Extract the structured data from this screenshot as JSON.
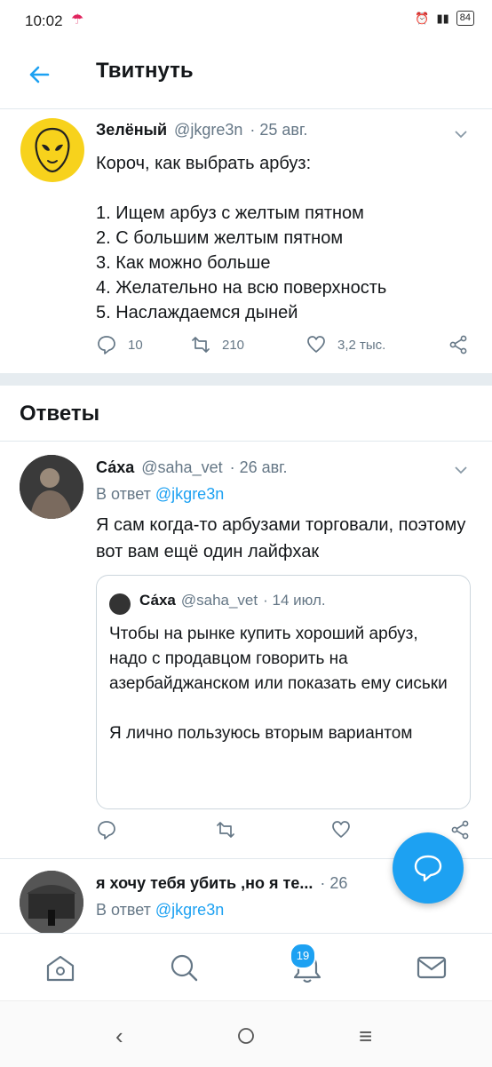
{
  "status_bar": {
    "time": "10:02",
    "battery": "84"
  },
  "header": {
    "title": "Твитнуть"
  },
  "main_tweet": {
    "author_name": "Зелёный",
    "handle": "@jkgre3n",
    "date": "· 25 авг.",
    "text_lines": [
      "Короч, как выбрать арбуз:",
      "",
      "1. Ищем арбуз с желтым пятном",
      "2. С большим желтым пятном",
      "3. Как можно больше",
      "4. Желательно на всю поверхность",
      "5. Наслаждаемся дыней"
    ],
    "replies_count": "10",
    "retweets_count": "210",
    "likes_count": "3,2 тыс."
  },
  "replies_section": {
    "title": "Ответы"
  },
  "reply1": {
    "author_name": "Са́ха",
    "handle": "@saha_vet",
    "date": "· 26 авг.",
    "reply_to_prefix": "В ответ",
    "reply_to_handle": "@jkgre3n",
    "text": "Я сам когда-то арбузами торговали, поэтому вот вам ещё один лайфхак",
    "quote": {
      "author_name": "Са́ха",
      "handle": "@saha_vet",
      "date": "· 14 июл.",
      "text_lines": [
        "Чтобы на рынке купить хороший арбуз, надо с продавцом говорить на азербайджанском или показать ему сиськи",
        "",
        "Я лично пользуюсь вторым вариантом"
      ]
    }
  },
  "reply2": {
    "author_name": "я хочу тебя убить ,но я те...",
    "date": "· 26",
    "reply_to_prefix": "В ответ",
    "reply_to_handle": "@jkgre3n"
  },
  "bottom_nav": {
    "notifications_badge": "19"
  },
  "colors": {
    "accent": "#1da1f2",
    "muted": "#657786",
    "avatar_yellow": "#f7d21c"
  }
}
